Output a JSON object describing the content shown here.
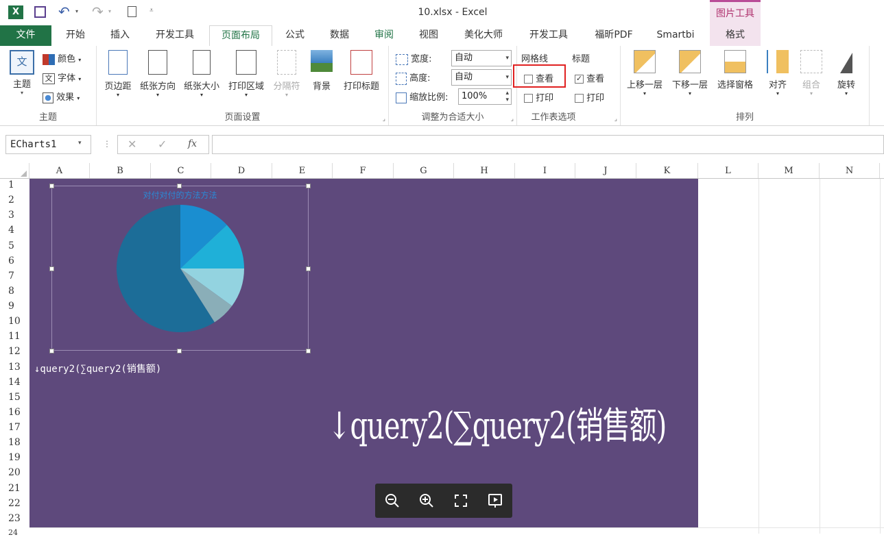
{
  "window": {
    "title": "10.xlsx - Excel",
    "context_tool_title": "图片工具"
  },
  "tabs": [
    {
      "label": "文件"
    },
    {
      "label": "开始"
    },
    {
      "label": "插入"
    },
    {
      "label": "开发工具"
    },
    {
      "label": "页面布局"
    },
    {
      "label": "公式"
    },
    {
      "label": "数据"
    },
    {
      "label": "审阅"
    },
    {
      "label": "视图"
    },
    {
      "label": "美化大师"
    },
    {
      "label": "开发工具"
    },
    {
      "label": "福昕PDF"
    },
    {
      "label": "Smartbi"
    },
    {
      "label": "格式"
    }
  ],
  "ribbon": {
    "theme": {
      "themes": "主题",
      "colors": "颜色",
      "fonts": "字体",
      "effects": "效果",
      "group": "主题"
    },
    "page_setup": {
      "margins": "页边距",
      "orientation": "纸张方向",
      "size": "纸张大小",
      "print_area": "打印区域",
      "breaks": "分隔符",
      "background": "背景",
      "print_titles": "打印标题",
      "group": "页面设置"
    },
    "scale": {
      "width_label": "宽度:",
      "width_value": "自动",
      "height_label": "高度:",
      "height_value": "自动",
      "scale_label": "缩放比例:",
      "scale_value": "100%",
      "group": "调整为合适大小"
    },
    "sheet_options": {
      "gridlines": "网格线",
      "headings": "标题",
      "view": "查看",
      "print": "打印",
      "group": "工作表选项",
      "gridlines_view_checked": false,
      "gridlines_print_checked": false,
      "headings_view_checked": true,
      "headings_print_checked": false
    },
    "arrange": {
      "bring_forward": "上移一层",
      "send_backward": "下移一层",
      "selection_pane": "选择窗格",
      "align": "对齐",
      "group_btn": "组合",
      "rotate": "旋转",
      "group": "排列"
    }
  },
  "formula_bar": {
    "name_box": "ECharts1",
    "fx": "fx",
    "formula": ""
  },
  "columns": [
    "A",
    "B",
    "C",
    "D",
    "E",
    "F",
    "G",
    "H",
    "I",
    "J",
    "K",
    "L",
    "M",
    "N"
  ],
  "rows": [
    "1",
    "2",
    "3",
    "4",
    "5",
    "6",
    "7",
    "8",
    "9",
    "10",
    "11",
    "12",
    "13",
    "14",
    "15",
    "16",
    "17",
    "18",
    "19",
    "20",
    "21",
    "22",
    "23",
    "24"
  ],
  "cells": {
    "a13_text": "↓query2(∑query2(销售额)",
    "big_text": "↓query2(∑query2(销售额)"
  },
  "chart_data": {
    "type": "pie",
    "title": "对付对付的方法方法",
    "slices": [
      {
        "value": 13,
        "color": "#1a8ed0"
      },
      {
        "value": 12,
        "color": "#1fb0d8"
      },
      {
        "value": 10,
        "color": "#93d3e0"
      },
      {
        "value": 6,
        "color": "#8aaeb8"
      },
      {
        "value": 59,
        "color": "#1c6d98"
      }
    ]
  },
  "colors": {
    "sheet_bg": "#5e497c",
    "accent": "#217346",
    "highlight_box": "#e02020"
  }
}
